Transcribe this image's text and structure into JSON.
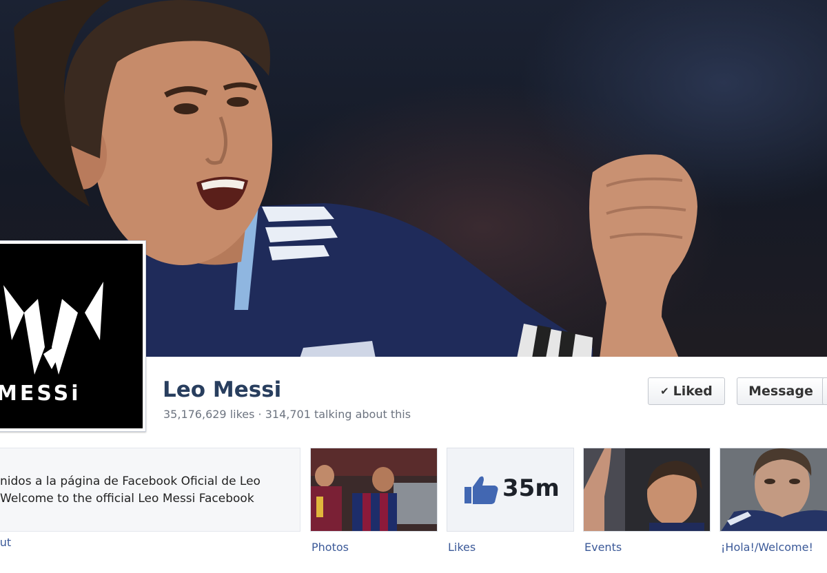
{
  "page": {
    "name": "Leo Messi",
    "stats": "35,176,629 likes · 314,701 talking about this",
    "profile_logo_text": "MESSi"
  },
  "actions": {
    "liked_label": "Liked",
    "message_label": "Message"
  },
  "about": {
    "line1": "nidos a la página de Facebook Oficial de Leo",
    "line2": "Welcome to the official Leo Messi Facebook",
    "label": "out"
  },
  "apps": [
    {
      "label": "Photos"
    },
    {
      "label": "Likes",
      "count": "35m"
    },
    {
      "label": "Events"
    },
    {
      "label": "¡Hola!/Welcome!"
    }
  ],
  "colors": {
    "link": "#3b5998",
    "name": "#283e5e",
    "jersey": "#1f2b5a"
  },
  "icons": {
    "liked": "check-icon",
    "likes_app": "thumbs-up-icon"
  }
}
